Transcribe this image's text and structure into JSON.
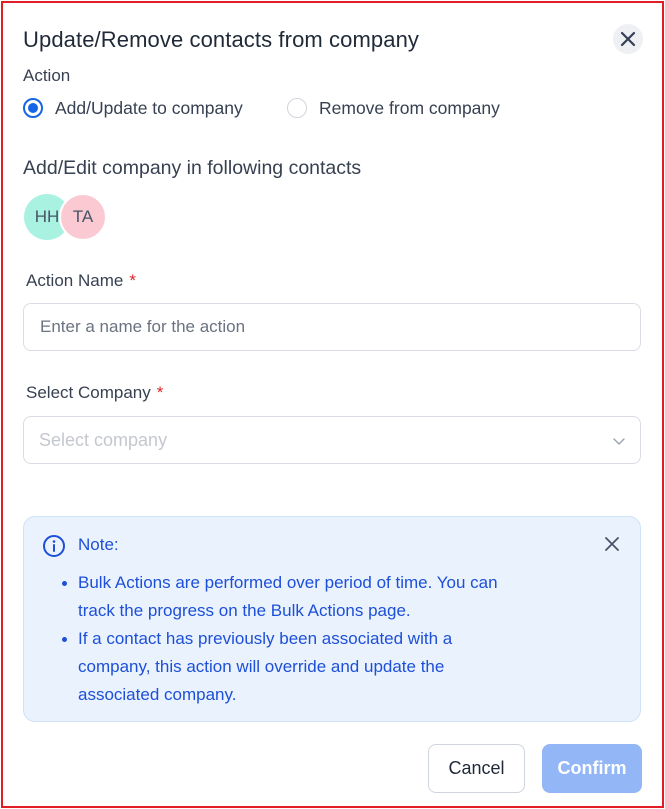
{
  "modal": {
    "title": "Update/Remove contacts from company",
    "action_label": "Action",
    "radio_options": [
      {
        "label": "Add/Update to company",
        "selected": true
      },
      {
        "label": "Remove from company",
        "selected": false
      }
    ],
    "contacts_heading": "Add/Edit company in following contacts",
    "avatars": [
      {
        "initials": "HH",
        "color": "#a9f2e1"
      },
      {
        "initials": "TA",
        "color": "#fbc9d2"
      }
    ],
    "action_name": {
      "label": "Action Name",
      "required_mark": "*",
      "placeholder": "Enter a name for the action",
      "value": ""
    },
    "select_company": {
      "label": "Select Company",
      "required_mark": "*",
      "placeholder": "Select company",
      "icon": "chevron-down-icon"
    },
    "note": {
      "title": "Note:",
      "icon": "info-icon",
      "items": [
        "Bulk Actions are performed over period of time. You can track the progress on the Bulk Actions page.",
        "If a contact has previously been associated with a company, this action will override and update the associated company."
      ]
    },
    "buttons": {
      "cancel": "Cancel",
      "confirm": "Confirm"
    }
  },
  "colors": {
    "primary": "#1565e6",
    "frame_border": "#e11d26",
    "note_bg": "#eaf3fd",
    "note_text": "#1d4fd8",
    "confirm_disabled": "#92b6f6",
    "required": "#dc2626"
  }
}
